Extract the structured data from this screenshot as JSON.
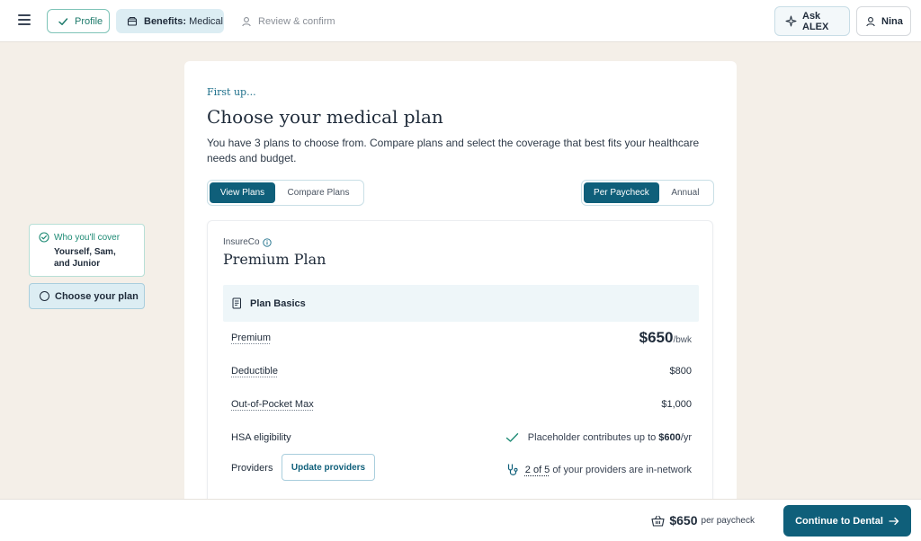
{
  "header": {
    "steps": [
      {
        "label": "Profile",
        "state": "complete"
      },
      {
        "label_bold": "Benefits:",
        "label": "Medical",
        "state": "active"
      },
      {
        "label": "Review & confirm",
        "state": "upcoming"
      }
    ],
    "ask_label": "Ask ALEX",
    "user_name": "Nina"
  },
  "sidebar": {
    "done_step": {
      "label": "Who you'll cover",
      "value": "Yourself, Sam, and Junior"
    },
    "current_step": {
      "label": "Choose your plan"
    }
  },
  "main": {
    "eyebrow": "First up...",
    "title": "Choose your medical plan",
    "description": "You have 3 plans to choose from. Compare plans and select the coverage that best fits your healthcare needs and budget.",
    "view_toggle": {
      "options": [
        "View Plans",
        "Compare Plans"
      ],
      "selected": "View Plans"
    },
    "period_toggle": {
      "options": [
        "Per Paycheck",
        "Annual"
      ],
      "selected": "Per Paycheck"
    },
    "plan": {
      "insurer": "InsureCo",
      "name": "Premium Plan",
      "section_title": "Plan Basics",
      "premium": {
        "label": "Premium",
        "value": "$650",
        "unit": "/bwk"
      },
      "deductible": {
        "label": "Deductible",
        "value": "$800"
      },
      "oop_max": {
        "label": "Out-of-Pocket Max",
        "value": "$1,000"
      },
      "hsa": {
        "label": "HSA eligibility",
        "text": "Placeholder contributes up to",
        "amount": "$600",
        "unit": "/yr"
      },
      "providers": {
        "label": "Providers",
        "button": "Update providers",
        "count": "2 of 5",
        "text": "of your providers are in-network"
      }
    }
  },
  "footer": {
    "total_value": "$650",
    "total_suffix": "per paycheck",
    "continue_label": "Continue to Dental"
  },
  "colors": {
    "primary": "#0f5f7a",
    "success": "#1d8a74",
    "background": "#f4efe8"
  }
}
